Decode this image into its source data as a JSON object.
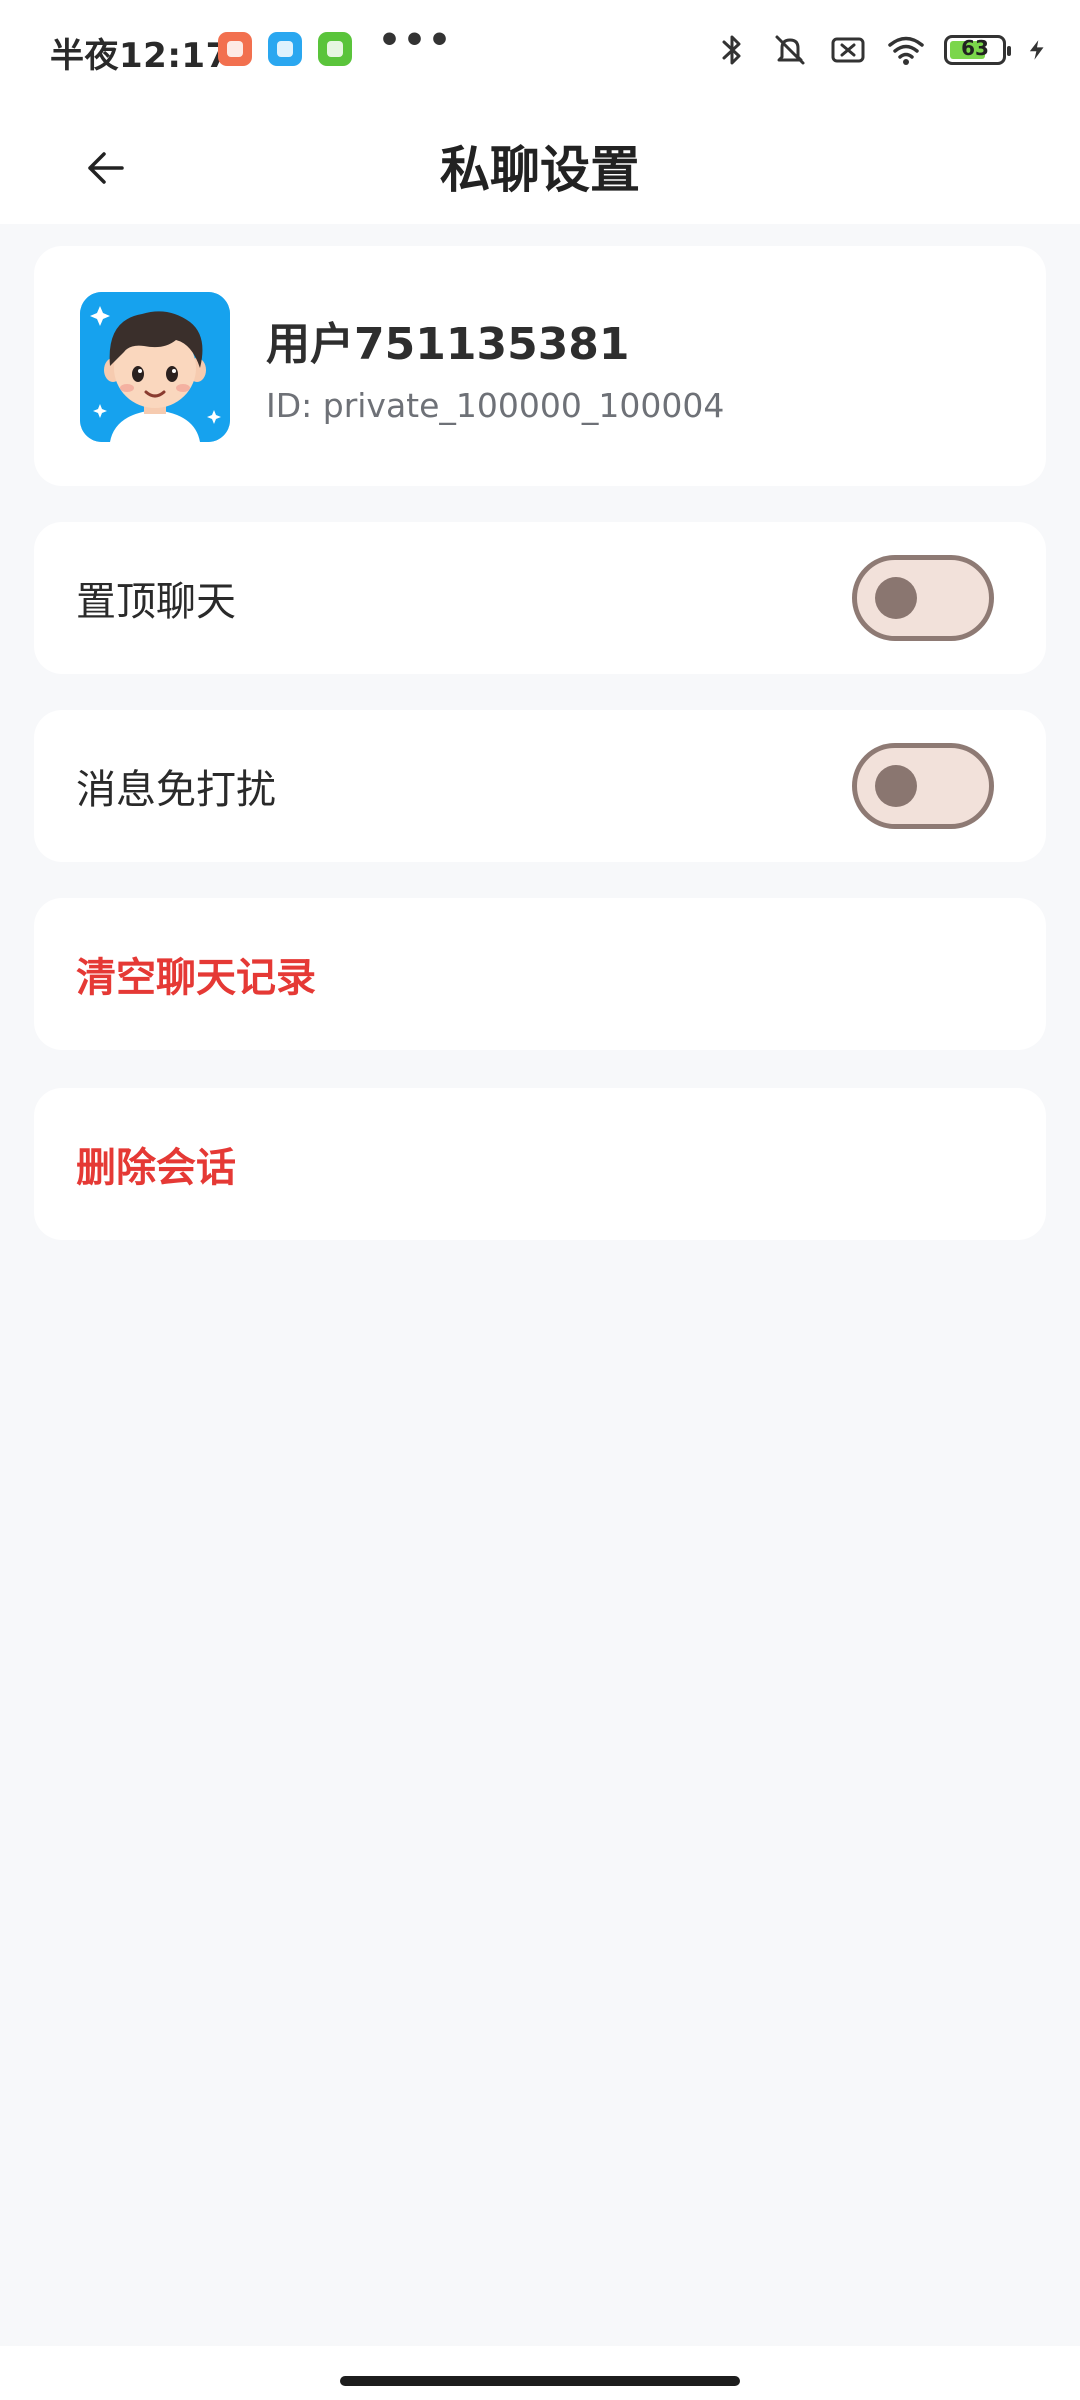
{
  "status_bar": {
    "time": "半夜12:17",
    "overflow": "•••",
    "battery_level": "63",
    "icons": [
      "app-notification-icon",
      "app-notification-icon",
      "app-notification-icon",
      "bluetooth-icon",
      "mute-icon",
      "sim-off-icon",
      "wifi-icon",
      "battery-icon",
      "charging-icon"
    ]
  },
  "header": {
    "title": "私聊设置",
    "back_icon": "back-arrow-icon"
  },
  "profile": {
    "name": "用户751135381",
    "id_text": "ID: private_100000_100004"
  },
  "settings": {
    "pin_chat": {
      "label": "置顶聊天",
      "enabled": false
    },
    "do_not_disturb": {
      "label": "消息免打扰",
      "enabled": false
    },
    "clear_history": {
      "label": "清空聊天记录"
    },
    "delete_conversation": {
      "label": "删除会话"
    }
  },
  "colors": {
    "danger": "#e53935",
    "background": "#f7f8fa",
    "card": "#ffffff",
    "toggle_off_track": "#f2e1da",
    "toggle_off_border": "#8e7a74"
  }
}
